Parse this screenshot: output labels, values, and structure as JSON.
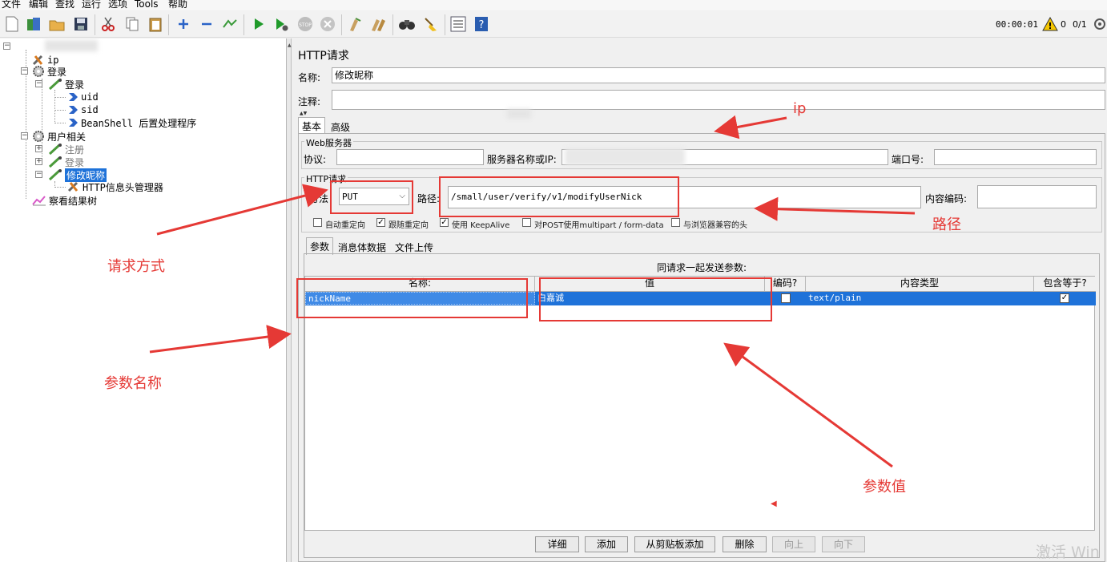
{
  "menu": [
    "文件",
    "编辑",
    "查找",
    "运行",
    "选项",
    "Tools",
    "帮助"
  ],
  "toolbar": {
    "timer": "00:00:01",
    "warn_count": "0",
    "thread_ratio": "0/1"
  },
  "tree": {
    "n_ip": "ip",
    "n_login_group": "登录",
    "n_login_sampler": "登录",
    "n_uid": "uid",
    "n_sid": "sid",
    "n_beanshell": "BeanShell 后置处理程序",
    "n_user_group": "用户相关",
    "n_register": "注册",
    "n_login2": "登录",
    "n_modify": "修改昵称",
    "n_header_mgr": "HTTP信息头管理器",
    "n_result_tree": "察看结果树"
  },
  "panel": {
    "title": "HTTP请求",
    "name_label": "名称:",
    "name_value": "修改昵称",
    "comment_label": "注释:",
    "tab_basic": "基本",
    "tab_advanced": "高级",
    "web_server_title": "Web服务器",
    "protocol_label": "协议:",
    "server_label": "服务器名称或IP:",
    "port_label": "端口号:",
    "http_req_title": "HTTP请求",
    "method_label": "方法",
    "method_value": "PUT",
    "path_label": "路径:",
    "path_value": "/small/user/verify/v1/modifyUserNick",
    "encoding_label": "内容编码:",
    "opt_auto_redirect": "自动重定向",
    "opt_follow_redirect": "跟随重定向",
    "opt_keepalive": "使用 KeepAlive",
    "opt_multipart": "对POST使用multipart / form-data",
    "opt_browser_headers": "与浏览器兼容的头",
    "opt_states": [
      false,
      true,
      true,
      false,
      false
    ],
    "subtab_params": "参数",
    "subtab_body": "消息体数据",
    "subtab_files": "文件上传",
    "params_caption": "同请求一起发送参数:",
    "col_name": "名称:",
    "col_value": "值",
    "col_encode": "编码?",
    "col_content_type": "内容类型",
    "col_include_equals": "包含等于?",
    "row": {
      "name": "nickName",
      "value": "白嘉诚",
      "encode": false,
      "content_type": "text/plain",
      "include_equals": true
    },
    "btn_detail": "详细",
    "btn_add": "添加",
    "btn_add_clipboard": "从剪贴板添加",
    "btn_delete": "删除",
    "btn_up": "向上",
    "btn_down": "向下"
  },
  "annotations": {
    "ip": "ip",
    "path": "路径",
    "method": "请求方式",
    "param_name": "参数名称",
    "param_value": "参数值"
  },
  "watermark": "激活 Win",
  "colors": {
    "selection": "#1e72d9",
    "annotation": "#e53935"
  }
}
